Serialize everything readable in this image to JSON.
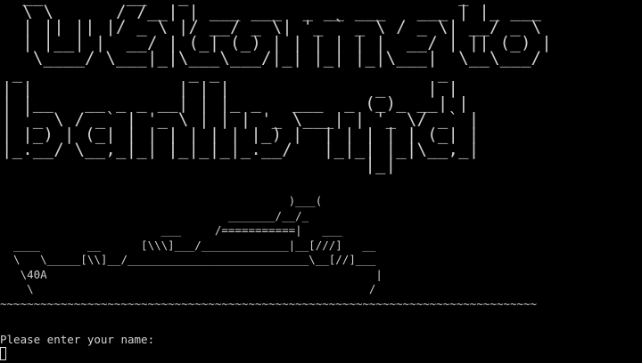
{
  "terminal": {
    "background": "#000000",
    "foreground": "#d0d0d0",
    "banner_art": "  __        __   _                          _\n  \\ \\      / /__| | ___ ___  _ __ ___   ___ | |_ ___\n  | || || |/ _ \\ |/ __/ _ \\| '_ ` _ \\ / _ \\| __/ _ \\\n  | |__| |  __/ | (_| (_) | | | | | |  __/ | || (_) |\n   \\____/ \\___|_|\\___\\___/|_| |_| |_|\\___|  \\__\\___/\n _                _ _                     _\n| |              | | |              _    | |\n| |__   __ _ _ __| | |_ _   ___  _ (_)_ __| |\n| '_ \\ / _` | '_ \\ | | | '_ \\___| | '_ \\/ _` |\n| |_) | (_| | | | | | | |_) |  | | | | | (_| |\n|_.__/ \\__,_|_| |_|_|_|_.__/   |_|_| |_|\\__,_|\n                                   |_|",
    "ship_art": "                                           )___(\n                                  _______/__/_\n                        ___     /===========|   ___\n  ____       __      [\\\\\\]___/_____________|__[///]   __\n  \\   \\_____[\\\\]__/___________________________\\__[//]___\n   \\40A                                                 |\n    \\                                                  /\n~~~~~~~~~~~~~~~~~~~~~~~~~~~~~~~~~~~~~~~~~~~~~~~~~~~~~~~~~~~~~~~~~~~~~~~~~~~~~~~~",
    "prompt": "Please enter your name:",
    "input_value": ""
  }
}
